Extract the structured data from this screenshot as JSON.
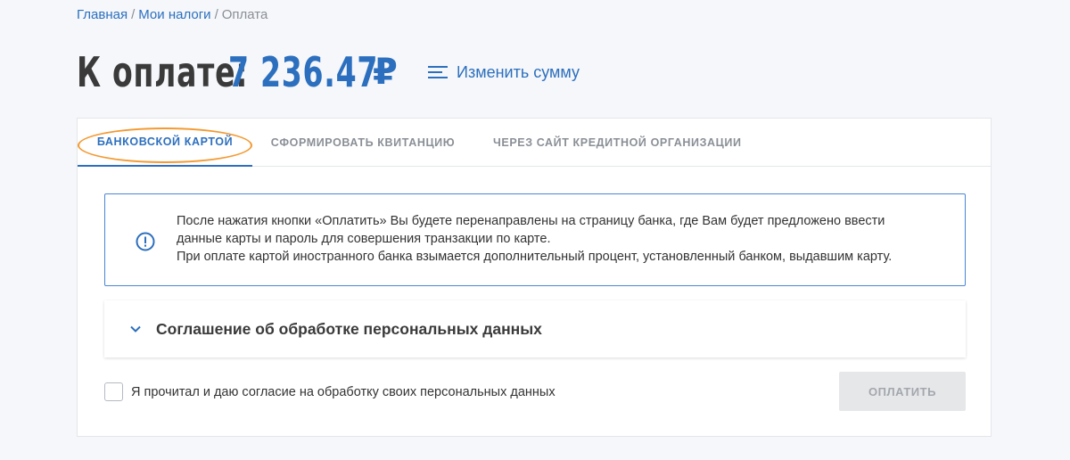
{
  "breadcrumb": {
    "items": [
      {
        "label": "Главная"
      },
      {
        "label": "Мои налоги"
      },
      {
        "label": "Оплата"
      }
    ],
    "separator": "/"
  },
  "header": {
    "title_label": "К оплате:",
    "amount": "7 236.47",
    "currency": "₽",
    "change_sum_label": "Изменить сумму"
  },
  "tabs": [
    {
      "label": "БАНКОВСКОЙ КАРТОЙ",
      "active": true
    },
    {
      "label": "СФОРМИРОВАТЬ КВИТАНЦИЮ",
      "active": false
    },
    {
      "label": "ЧЕРЕЗ САЙТ КРЕДИТНОЙ ОРГАНИЗАЦИИ",
      "active": false
    }
  ],
  "info": {
    "icon": "info-icon",
    "lines": [
      "После нажатия кнопки «Оплатить» Вы будете перенаправлены на страницу банка, где Вам будет предложено ввести",
      "данные карты и пароль для совершения транзакции по карте.",
      "При оплате картой иностранного банка взымается дополнительный процент, установленный банком, выдавшим карту."
    ]
  },
  "accordion": {
    "title": "Соглашение об обработке персональных данных",
    "icon": "chevron-down-icon"
  },
  "agreement": {
    "label": "Я прочитал и даю согласие на обработку своих персональных данных",
    "checked": false
  },
  "pay_button": {
    "label": "ОПЛАТИТЬ",
    "disabled": true
  },
  "colors": {
    "accent": "#2c6fbe",
    "highlight": "#f39a32",
    "disabled_bg": "#e6e7e9"
  }
}
